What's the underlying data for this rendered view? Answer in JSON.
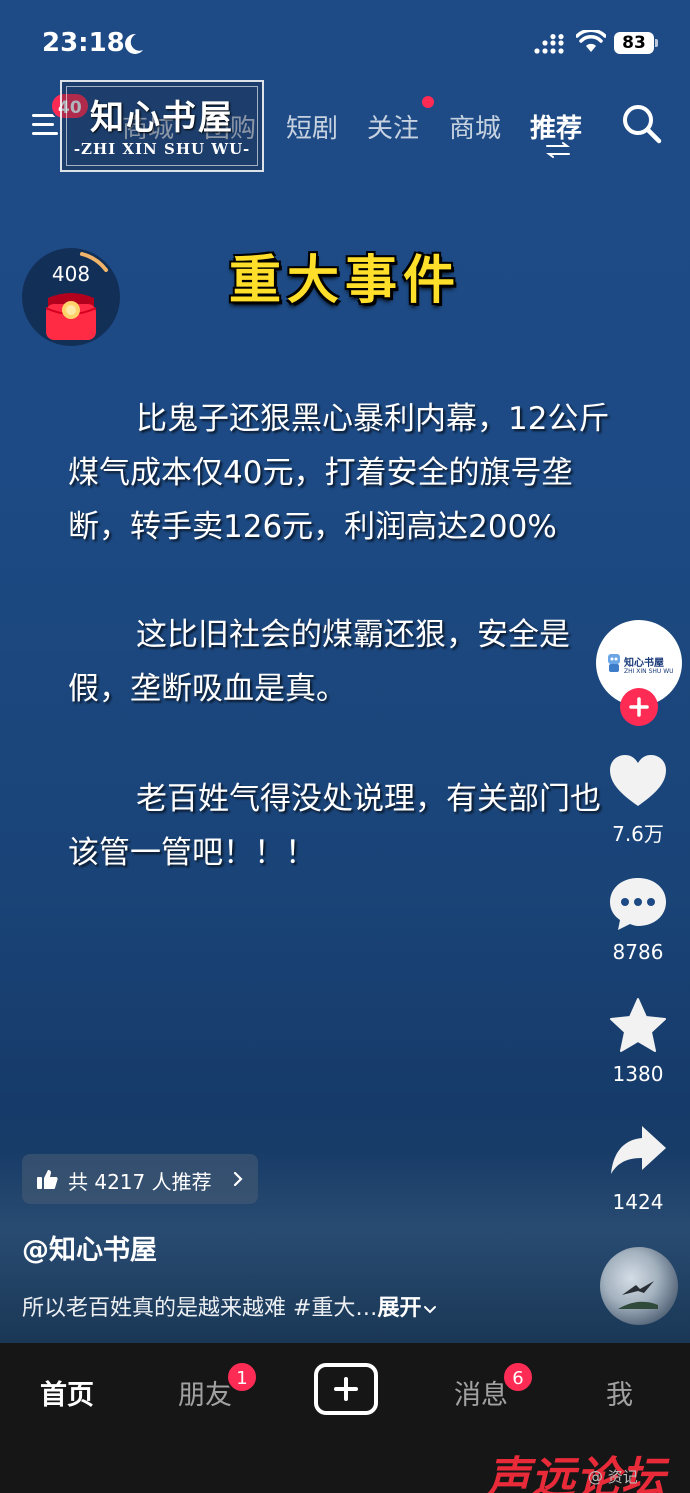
{
  "status_bar": {
    "time": "23:18",
    "battery": "83"
  },
  "top_nav": {
    "menu_badge": "40",
    "tabs": [
      {
        "label": "商城"
      },
      {
        "label": "团购"
      },
      {
        "label": "短剧"
      },
      {
        "label": "关注"
      },
      {
        "label": "商城"
      },
      {
        "label": "推荐"
      }
    ]
  },
  "watermark_logo": {
    "title": "知心书屋",
    "subtitle": "-ZHI XIN SHU WU-"
  },
  "red_packet": {
    "count": "408"
  },
  "video": {
    "headline": "重大事件",
    "paragraphs": [
      "比鬼子还狠黑心暴利内幕，12公斤煤气成本仅40元，打着安全的旗号垄断，转手卖126元，利润高达200%",
      "这比旧社会的煤霸还狠，安全是假，垄断吸血是真。",
      "老百姓气得没处说理，有关部门也该管一管吧！！！"
    ]
  },
  "actions": {
    "avatar_label": "知心书屋",
    "avatar_sub": "ZHI XIN SHU WU",
    "likes": "7.6万",
    "comments": "8786",
    "favorites": "1380",
    "shares": "1424"
  },
  "info": {
    "recommend": "共 4217 人推荐",
    "author": "@知心书屋",
    "caption": "所以老百姓真的是越来越难 #重大…",
    "expand": "展开"
  },
  "bottom_tabs": {
    "home": "首页",
    "friends": "朋友",
    "friends_badge": "1",
    "messages": "消息",
    "messages_badge": "6",
    "me": "我"
  },
  "forum_watermark": {
    "text": "声远论坛",
    "small": "@ 资记"
  },
  "colors": {
    "accent": "#fe2c55",
    "headline": "#ffdf2a",
    "background": "#1d4a84"
  }
}
